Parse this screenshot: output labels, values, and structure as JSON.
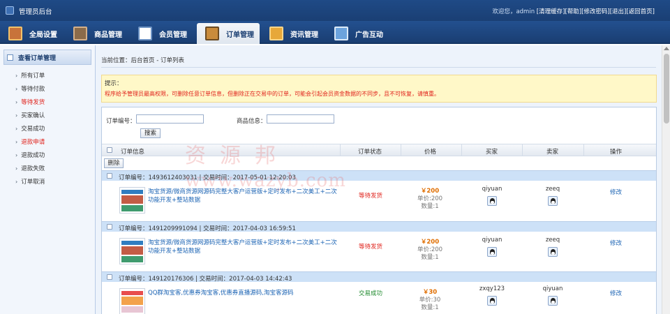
{
  "app": {
    "title": "管理员后台"
  },
  "top_links": {
    "greeting": "欢迎您，admin",
    "items": [
      "[清理缓存]",
      "[帮助]",
      "[修改密码]",
      "[退出]",
      "[返回首页]"
    ]
  },
  "nav": {
    "items": [
      {
        "label": "全局设置",
        "icon": "home-settings-icon"
      },
      {
        "label": "商品管理",
        "icon": "grid-goods-icon"
      },
      {
        "label": "会员管理",
        "icon": "member-card-icon"
      },
      {
        "label": "订单管理",
        "icon": "order-box-icon",
        "active": true
      },
      {
        "label": "资讯管理",
        "icon": "news-book-icon"
      },
      {
        "label": "广告互动",
        "icon": "ad-window-icon"
      }
    ]
  },
  "sidebar": {
    "title": "查看订单管理",
    "items": [
      {
        "label": "所有订单",
        "red": false
      },
      {
        "label": "等待付款",
        "red": false
      },
      {
        "label": "等待发货",
        "red": true
      },
      {
        "label": "买家确认",
        "red": false
      },
      {
        "label": "交易成功",
        "red": false
      },
      {
        "label": "退款申请",
        "red": true
      },
      {
        "label": "退款成功",
        "red": false
      },
      {
        "label": "退款失败",
        "red": false
      },
      {
        "label": "订单取消",
        "red": false
      }
    ]
  },
  "breadcrumb": "当前位置：后台首页 - 订单列表",
  "tips": {
    "title": "提示：",
    "text": "程序给予管理员最高权限，可删除任意订单信息，但删除正在交易中的订单，可能会引起会员资金数据的不同步，且不可恢复，请慎重。"
  },
  "filters": {
    "order_no_label": "订单编号：",
    "order_no_value": "",
    "goods_label": "商品信息：",
    "goods_value": "",
    "search_button": "搜索"
  },
  "table": {
    "headers": [
      "订单信息",
      "订单状态",
      "价格",
      "买家",
      "卖家",
      "操作"
    ],
    "delete_button": "删除",
    "orders": [
      {
        "header": "订单编号：1493612403031 | 交易时间：2017-05-01 12:20:03",
        "goods": "淘宝货源/微商货源网源码完整大客户运营版+定时发布+二次美工+二次功能开发+整站数据",
        "status": "等待发货",
        "status_color": "#e0231c",
        "price": "￥200",
        "unit_price": "单价:200",
        "quantity": "数量:1",
        "buyer": "qiyuan",
        "seller": "zeeq",
        "action": "修改"
      },
      {
        "header": "订单编号：1491209991094 | 交易时间：2017-04-03 16:59:51",
        "goods": "淘宝货源/微商货源网源码完整大客户运营版+定时发布+二次美工+二次功能开发+整站数据",
        "status": "等待发货",
        "status_color": "#e0231c",
        "price": "￥200",
        "unit_price": "单价:200",
        "quantity": "数量:1",
        "buyer": "qiyuan",
        "seller": "zeeq",
        "action": "修改"
      },
      {
        "header": "订单编号：149120176306 | 交易时间：2017-04-03 14:42:43",
        "goods": "QQ群淘宝客,优惠券淘宝客,优惠券直播源码,淘宝客源码",
        "status": "交易成功",
        "status_color": "#1f8a2e",
        "price": "￥30",
        "unit_price": "单价:30",
        "quantity": "数量:1",
        "buyer": "zxqy123",
        "seller": "qiyuan",
        "action": "修改"
      }
    ]
  },
  "watermark": {
    "line1": "资源邦",
    "line2": "www.wazyb.com"
  },
  "colors": {
    "nav_bg": "#1f4a86",
    "tips_bg": "#fff8c8",
    "order_header_bg": "#cde1f7",
    "red": "#e0231c",
    "link": "#1c64b4"
  }
}
